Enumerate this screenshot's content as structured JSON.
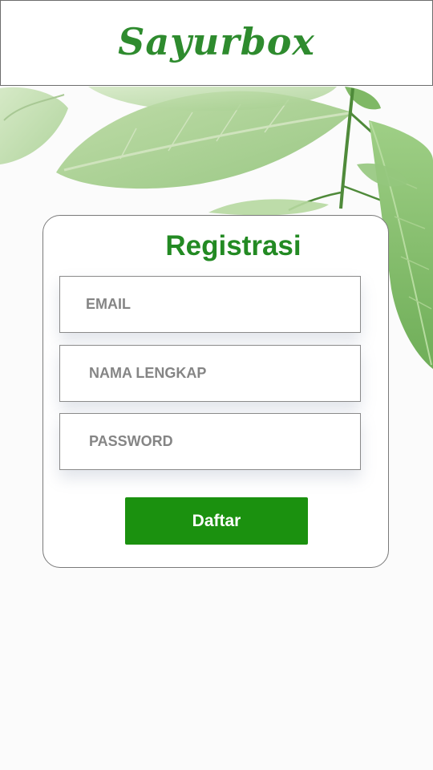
{
  "header": {
    "logo": "Sayurbox"
  },
  "form": {
    "title": "Registrasi",
    "email_placeholder": "EMAIL",
    "name_placeholder": "NAMA LENGKAP",
    "password_placeholder": "PASSWORD",
    "submit_label": "Daftar"
  },
  "colors": {
    "brand_green": "#2e8b2e",
    "button_green": "#1b910f"
  }
}
